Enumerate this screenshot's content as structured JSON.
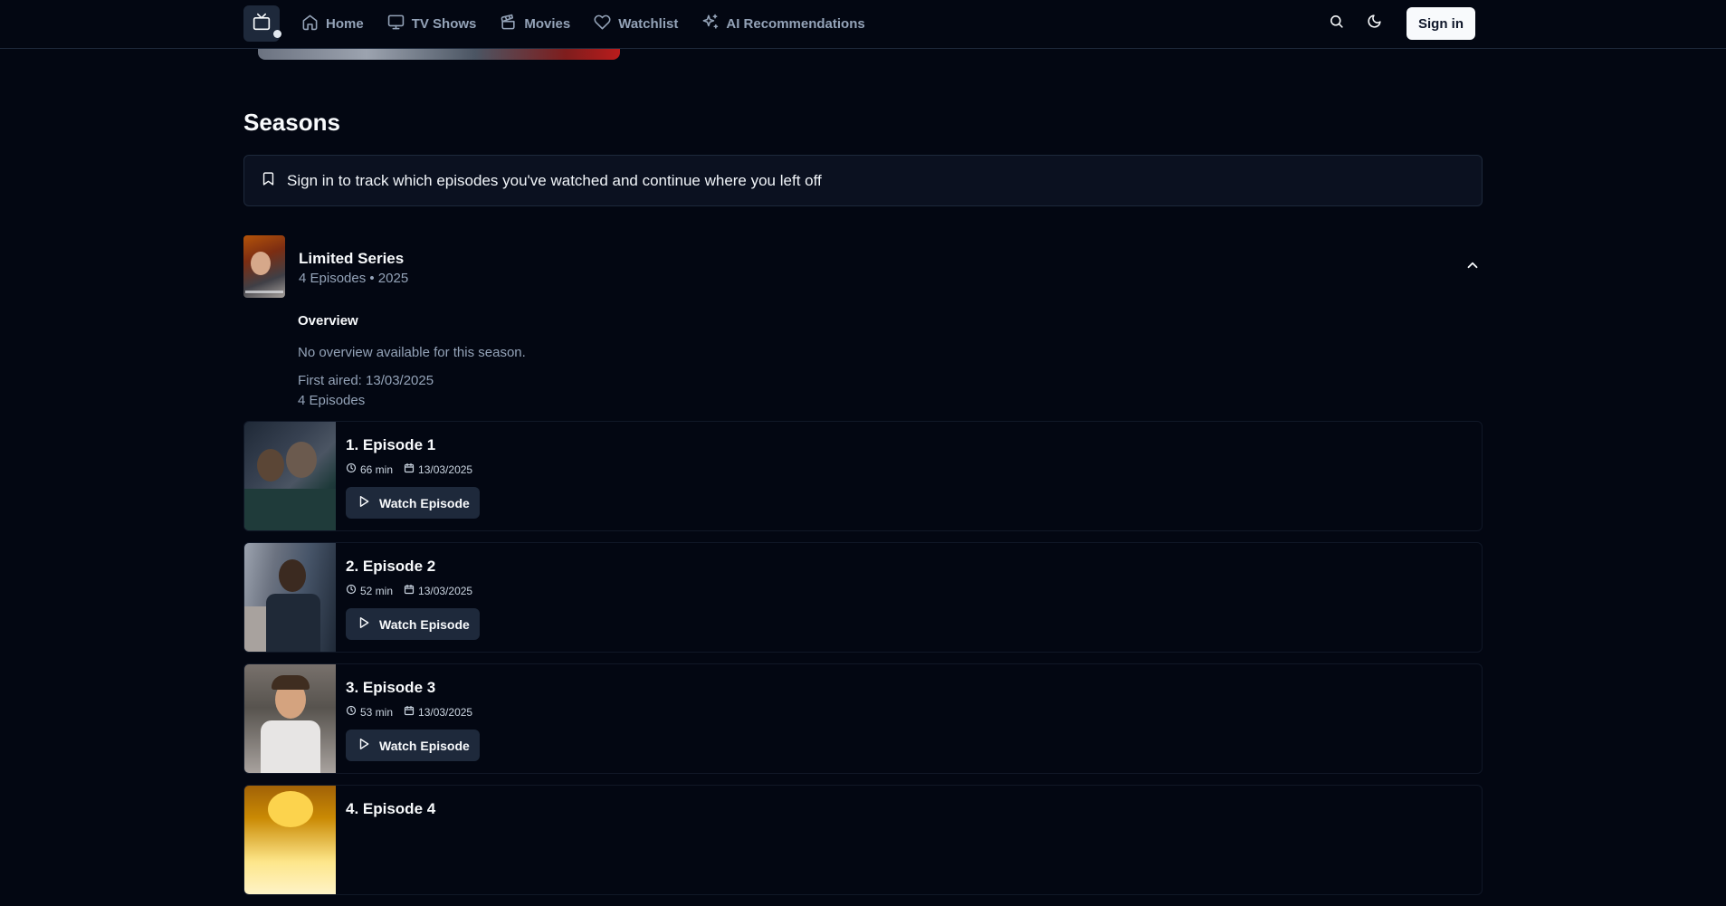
{
  "nav": {
    "links": [
      {
        "label": "Home",
        "icon": "home-icon"
      },
      {
        "label": "TV Shows",
        "icon": "tv-icon"
      },
      {
        "label": "Movies",
        "icon": "clapperboard-icon"
      },
      {
        "label": "Watchlist",
        "icon": "heart-icon"
      },
      {
        "label": "AI Recommendations",
        "icon": "sparkles-icon"
      }
    ],
    "signin_label": "Sign in"
  },
  "seasons": {
    "title": "Seasons",
    "notice": "Sign in to track which episodes you've watched and continue where you left off",
    "season": {
      "title": "Limited Series",
      "meta": "4 Episodes • 2025",
      "overview_title": "Overview",
      "overview_text": "No overview available for this season.",
      "first_aired": "First aired: 13/03/2025",
      "episode_count": "4 Episodes"
    },
    "episodes": [
      {
        "title": "1. Episode 1",
        "runtime": "66 min",
        "date": "13/03/2025",
        "watch_label": "Watch Episode"
      },
      {
        "title": "2. Episode 2",
        "runtime": "52 min",
        "date": "13/03/2025",
        "watch_label": "Watch Episode"
      },
      {
        "title": "3. Episode 3",
        "runtime": "53 min",
        "date": "13/03/2025",
        "watch_label": "Watch Episode"
      },
      {
        "title": "4. Episode 4",
        "runtime": "",
        "date": "",
        "watch_label": ""
      }
    ]
  },
  "colors": {
    "background": "#030712",
    "surface": "#1e293b",
    "muted_text": "#94a3b8",
    "primary_button": "#f8fafc"
  }
}
